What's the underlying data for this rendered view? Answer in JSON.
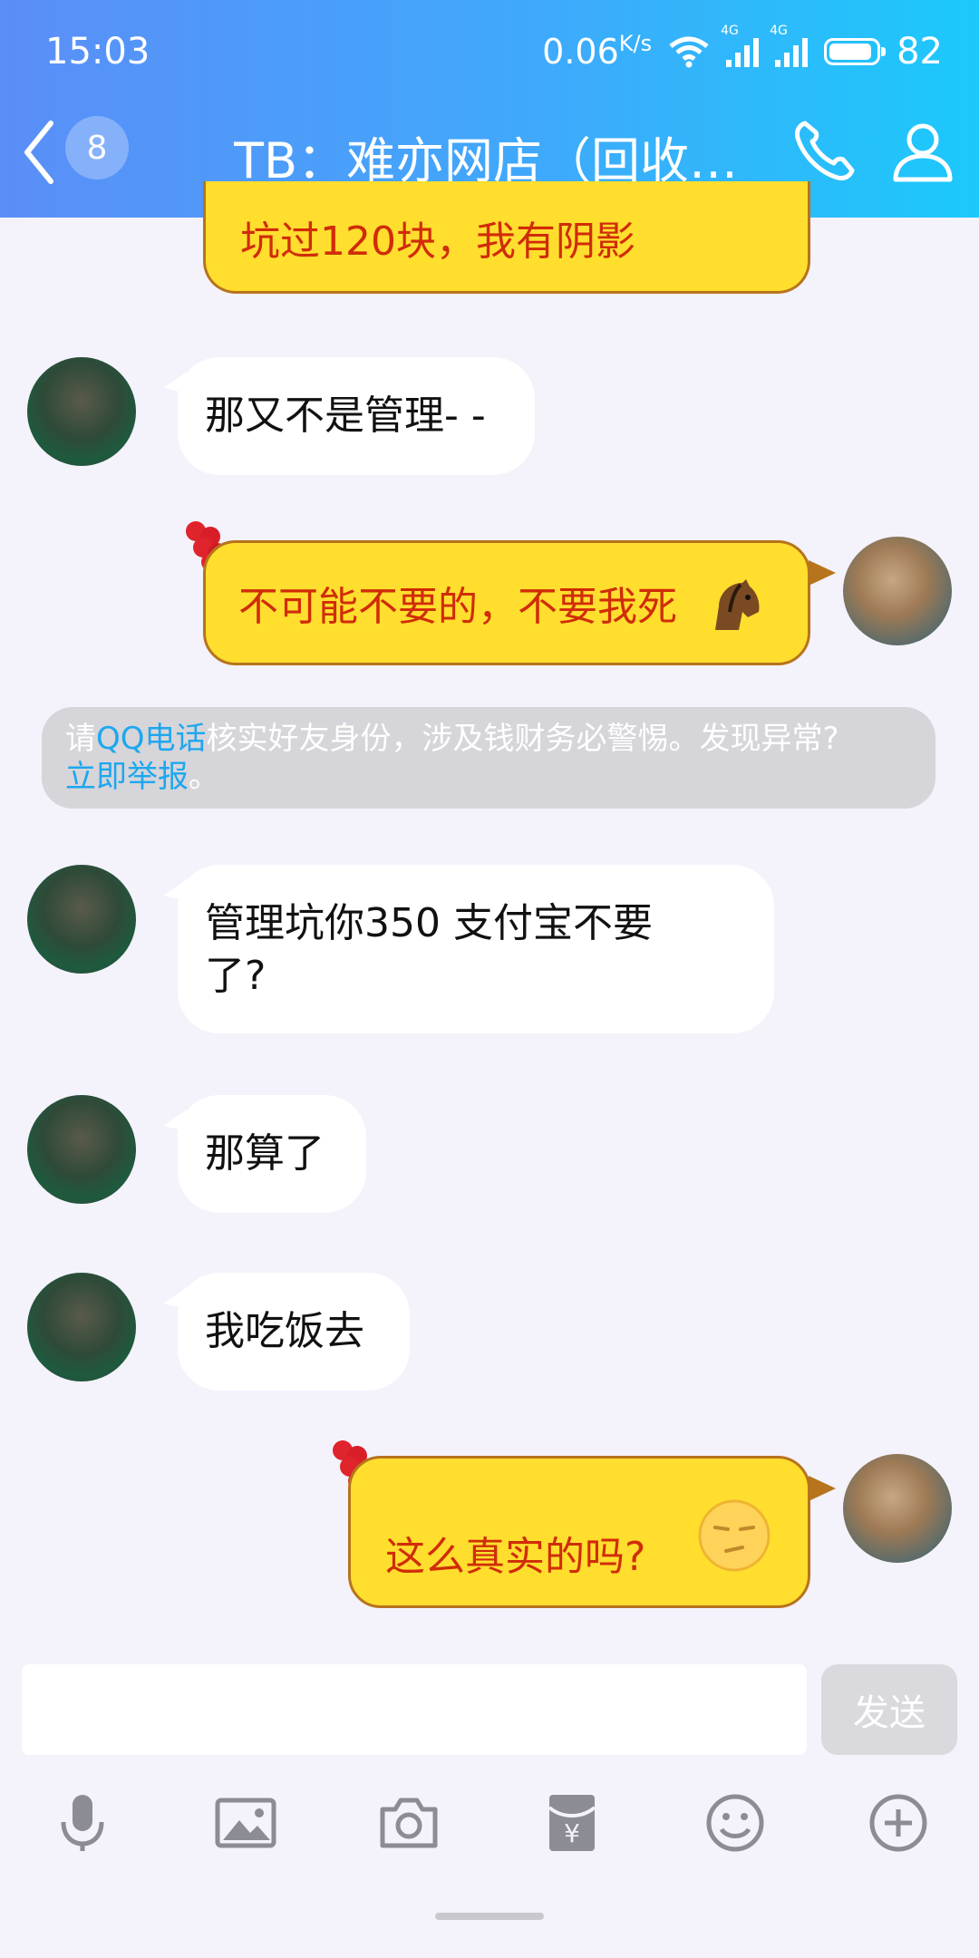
{
  "status": {
    "time": "15:03",
    "net_speed": "0.06",
    "net_unit": "K/s",
    "net_type_1": "4G",
    "net_type_2": "4G",
    "battery": "82"
  },
  "header": {
    "unread_count": "8",
    "title": "TB：难亦网店（回收…"
  },
  "messages": [
    {
      "side": "right",
      "text": "坑过120块，我有阴影"
    },
    {
      "side": "left",
      "text": "那又不是管理- -"
    },
    {
      "side": "right",
      "text": "不可能不要的，不要我死",
      "emoji": "horse-emoji"
    },
    {
      "side": "left",
      "text_line1": "管理坑你350  支付宝不要",
      "text_line2": "了?"
    },
    {
      "side": "left",
      "text": "那算了"
    },
    {
      "side": "left",
      "text": "我吃饭去"
    },
    {
      "side": "right",
      "text": "这么真实的吗?",
      "emoji": "smirk-emoji"
    }
  ],
  "notice": {
    "prefix": "请",
    "link1": "QQ电话",
    "middle": "核实好友身份，涉及钱财务必警惕。发现异常?",
    "link2": "立即举报",
    "suffix": "。"
  },
  "composer": {
    "send_label": "发送",
    "input_value": ""
  },
  "toolbar": {
    "icons": [
      "microphone-icon",
      "image-icon",
      "camera-icon",
      "red-packet-icon",
      "emoji-icon",
      "plus-icon"
    ]
  },
  "colors": {
    "header_start": "#5b8ef7",
    "header_end": "#1cc9fb",
    "bubble_yellow": "#ffde2e",
    "bubble_text_red": "#d02c08",
    "link_blue": "#1ea7ee"
  }
}
